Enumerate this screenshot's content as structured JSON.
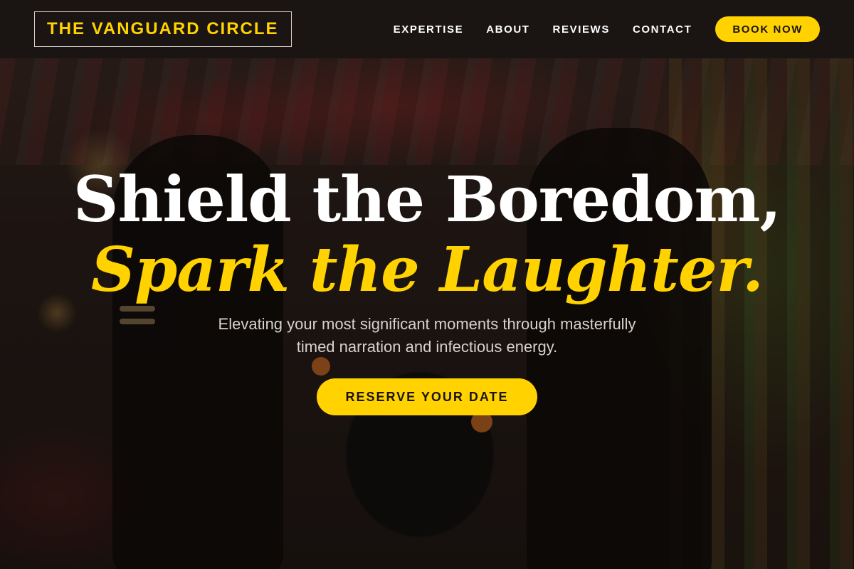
{
  "header": {
    "brand": "THE VANGUARD CIRCLE",
    "nav": [
      {
        "label": "EXPERTISE"
      },
      {
        "label": "ABOUT"
      },
      {
        "label": "REVIEWS"
      },
      {
        "label": "CONTACT"
      }
    ],
    "book_label": "BOOK NOW"
  },
  "hero": {
    "headline_line1": "Shield the Boredom,",
    "headline_line2": "Spark the Laughter.",
    "tagline": "Elevating your most significant moments through masterfully timed narration and infectious energy.",
    "cta_label": "RESERVE YOUR DATE"
  },
  "colors": {
    "accent": "#ffd200",
    "header_bg": "#181412",
    "text_light": "#ffffff"
  }
}
